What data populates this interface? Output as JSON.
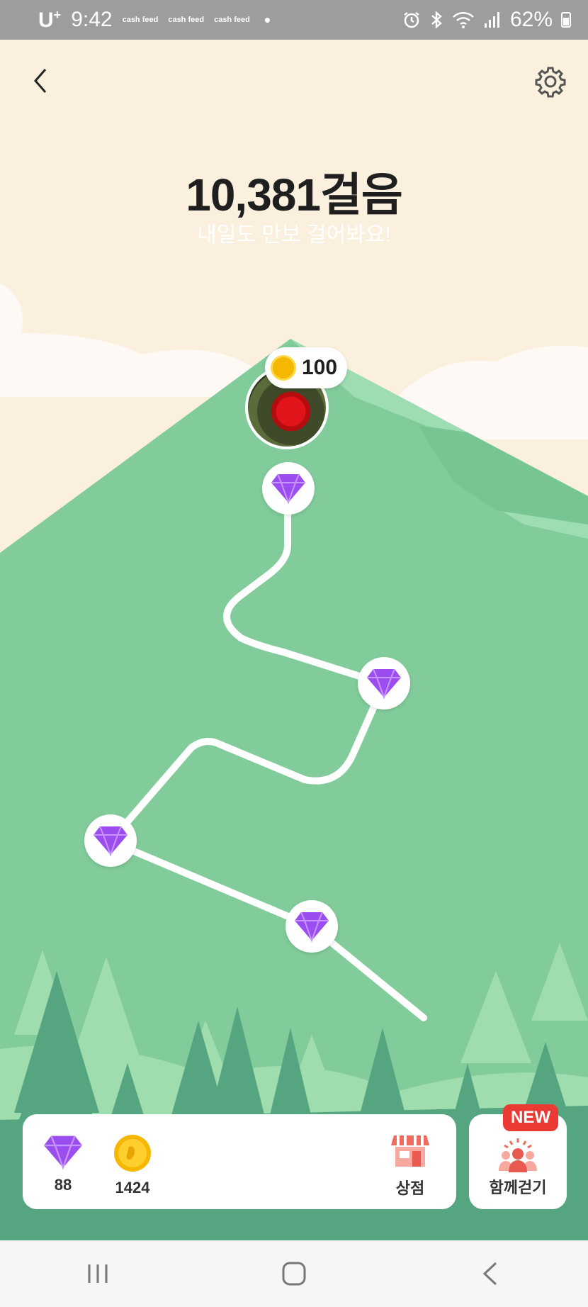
{
  "status_bar": {
    "carrier": "U",
    "carrier_sup": "+",
    "time": "9:42",
    "notification_apps": [
      "cash feed",
      "cash feed",
      "cash feed"
    ],
    "notification_dot": "•",
    "battery_percent": "62%"
  },
  "header": {
    "steps_title": "10,381걸음",
    "subtitle": "내일도 만보 걸어봐요!"
  },
  "trail": {
    "reward_amount": "100",
    "checkpoints": [
      "diamond-icon",
      "diamond-icon",
      "diamond-icon",
      "diamond-icon"
    ]
  },
  "wallet": {
    "diamonds": "88",
    "coins": "1424",
    "shop_label": "상점"
  },
  "together": {
    "label": "함께걷기",
    "badge": "NEW"
  },
  "colors": {
    "mountain": "#82cc9b",
    "forest_dark": "#55a680",
    "sky": "#fbf0de",
    "badge": "#ea3a33",
    "diamond": "#9b4df0"
  }
}
